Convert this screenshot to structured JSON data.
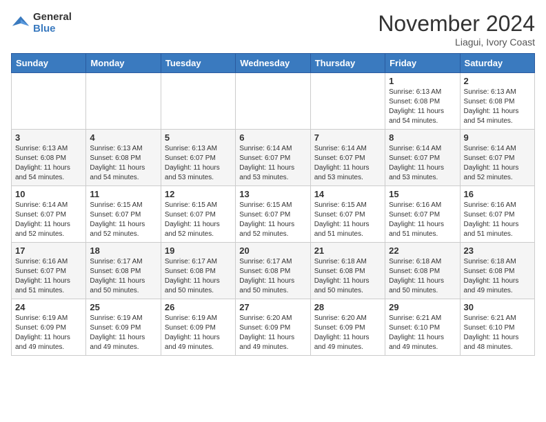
{
  "logo": {
    "line1": "General",
    "line2": "Blue"
  },
  "title": "November 2024",
  "subtitle": "Liagui, Ivory Coast",
  "days_header": [
    "Sunday",
    "Monday",
    "Tuesday",
    "Wednesday",
    "Thursday",
    "Friday",
    "Saturday"
  ],
  "weeks": [
    [
      {
        "day": "",
        "info": ""
      },
      {
        "day": "",
        "info": ""
      },
      {
        "day": "",
        "info": ""
      },
      {
        "day": "",
        "info": ""
      },
      {
        "day": "",
        "info": ""
      },
      {
        "day": "1",
        "info": "Sunrise: 6:13 AM\nSunset: 6:08 PM\nDaylight: 11 hours and 54 minutes."
      },
      {
        "day": "2",
        "info": "Sunrise: 6:13 AM\nSunset: 6:08 PM\nDaylight: 11 hours and 54 minutes."
      }
    ],
    [
      {
        "day": "3",
        "info": "Sunrise: 6:13 AM\nSunset: 6:08 PM\nDaylight: 11 hours and 54 minutes."
      },
      {
        "day": "4",
        "info": "Sunrise: 6:13 AM\nSunset: 6:08 PM\nDaylight: 11 hours and 54 minutes."
      },
      {
        "day": "5",
        "info": "Sunrise: 6:13 AM\nSunset: 6:07 PM\nDaylight: 11 hours and 53 minutes."
      },
      {
        "day": "6",
        "info": "Sunrise: 6:14 AM\nSunset: 6:07 PM\nDaylight: 11 hours and 53 minutes."
      },
      {
        "day": "7",
        "info": "Sunrise: 6:14 AM\nSunset: 6:07 PM\nDaylight: 11 hours and 53 minutes."
      },
      {
        "day": "8",
        "info": "Sunrise: 6:14 AM\nSunset: 6:07 PM\nDaylight: 11 hours and 53 minutes."
      },
      {
        "day": "9",
        "info": "Sunrise: 6:14 AM\nSunset: 6:07 PM\nDaylight: 11 hours and 52 minutes."
      }
    ],
    [
      {
        "day": "10",
        "info": "Sunrise: 6:14 AM\nSunset: 6:07 PM\nDaylight: 11 hours and 52 minutes."
      },
      {
        "day": "11",
        "info": "Sunrise: 6:15 AM\nSunset: 6:07 PM\nDaylight: 11 hours and 52 minutes."
      },
      {
        "day": "12",
        "info": "Sunrise: 6:15 AM\nSunset: 6:07 PM\nDaylight: 11 hours and 52 minutes."
      },
      {
        "day": "13",
        "info": "Sunrise: 6:15 AM\nSunset: 6:07 PM\nDaylight: 11 hours and 52 minutes."
      },
      {
        "day": "14",
        "info": "Sunrise: 6:15 AM\nSunset: 6:07 PM\nDaylight: 11 hours and 51 minutes."
      },
      {
        "day": "15",
        "info": "Sunrise: 6:16 AM\nSunset: 6:07 PM\nDaylight: 11 hours and 51 minutes."
      },
      {
        "day": "16",
        "info": "Sunrise: 6:16 AM\nSunset: 6:07 PM\nDaylight: 11 hours and 51 minutes."
      }
    ],
    [
      {
        "day": "17",
        "info": "Sunrise: 6:16 AM\nSunset: 6:07 PM\nDaylight: 11 hours and 51 minutes."
      },
      {
        "day": "18",
        "info": "Sunrise: 6:17 AM\nSunset: 6:08 PM\nDaylight: 11 hours and 50 minutes."
      },
      {
        "day": "19",
        "info": "Sunrise: 6:17 AM\nSunset: 6:08 PM\nDaylight: 11 hours and 50 minutes."
      },
      {
        "day": "20",
        "info": "Sunrise: 6:17 AM\nSunset: 6:08 PM\nDaylight: 11 hours and 50 minutes."
      },
      {
        "day": "21",
        "info": "Sunrise: 6:18 AM\nSunset: 6:08 PM\nDaylight: 11 hours and 50 minutes."
      },
      {
        "day": "22",
        "info": "Sunrise: 6:18 AM\nSunset: 6:08 PM\nDaylight: 11 hours and 50 minutes."
      },
      {
        "day": "23",
        "info": "Sunrise: 6:18 AM\nSunset: 6:08 PM\nDaylight: 11 hours and 49 minutes."
      }
    ],
    [
      {
        "day": "24",
        "info": "Sunrise: 6:19 AM\nSunset: 6:09 PM\nDaylight: 11 hours and 49 minutes."
      },
      {
        "day": "25",
        "info": "Sunrise: 6:19 AM\nSunset: 6:09 PM\nDaylight: 11 hours and 49 minutes."
      },
      {
        "day": "26",
        "info": "Sunrise: 6:19 AM\nSunset: 6:09 PM\nDaylight: 11 hours and 49 minutes."
      },
      {
        "day": "27",
        "info": "Sunrise: 6:20 AM\nSunset: 6:09 PM\nDaylight: 11 hours and 49 minutes."
      },
      {
        "day": "28",
        "info": "Sunrise: 6:20 AM\nSunset: 6:09 PM\nDaylight: 11 hours and 49 minutes."
      },
      {
        "day": "29",
        "info": "Sunrise: 6:21 AM\nSunset: 6:10 PM\nDaylight: 11 hours and 49 minutes."
      },
      {
        "day": "30",
        "info": "Sunrise: 6:21 AM\nSunset: 6:10 PM\nDaylight: 11 hours and 48 minutes."
      }
    ]
  ]
}
